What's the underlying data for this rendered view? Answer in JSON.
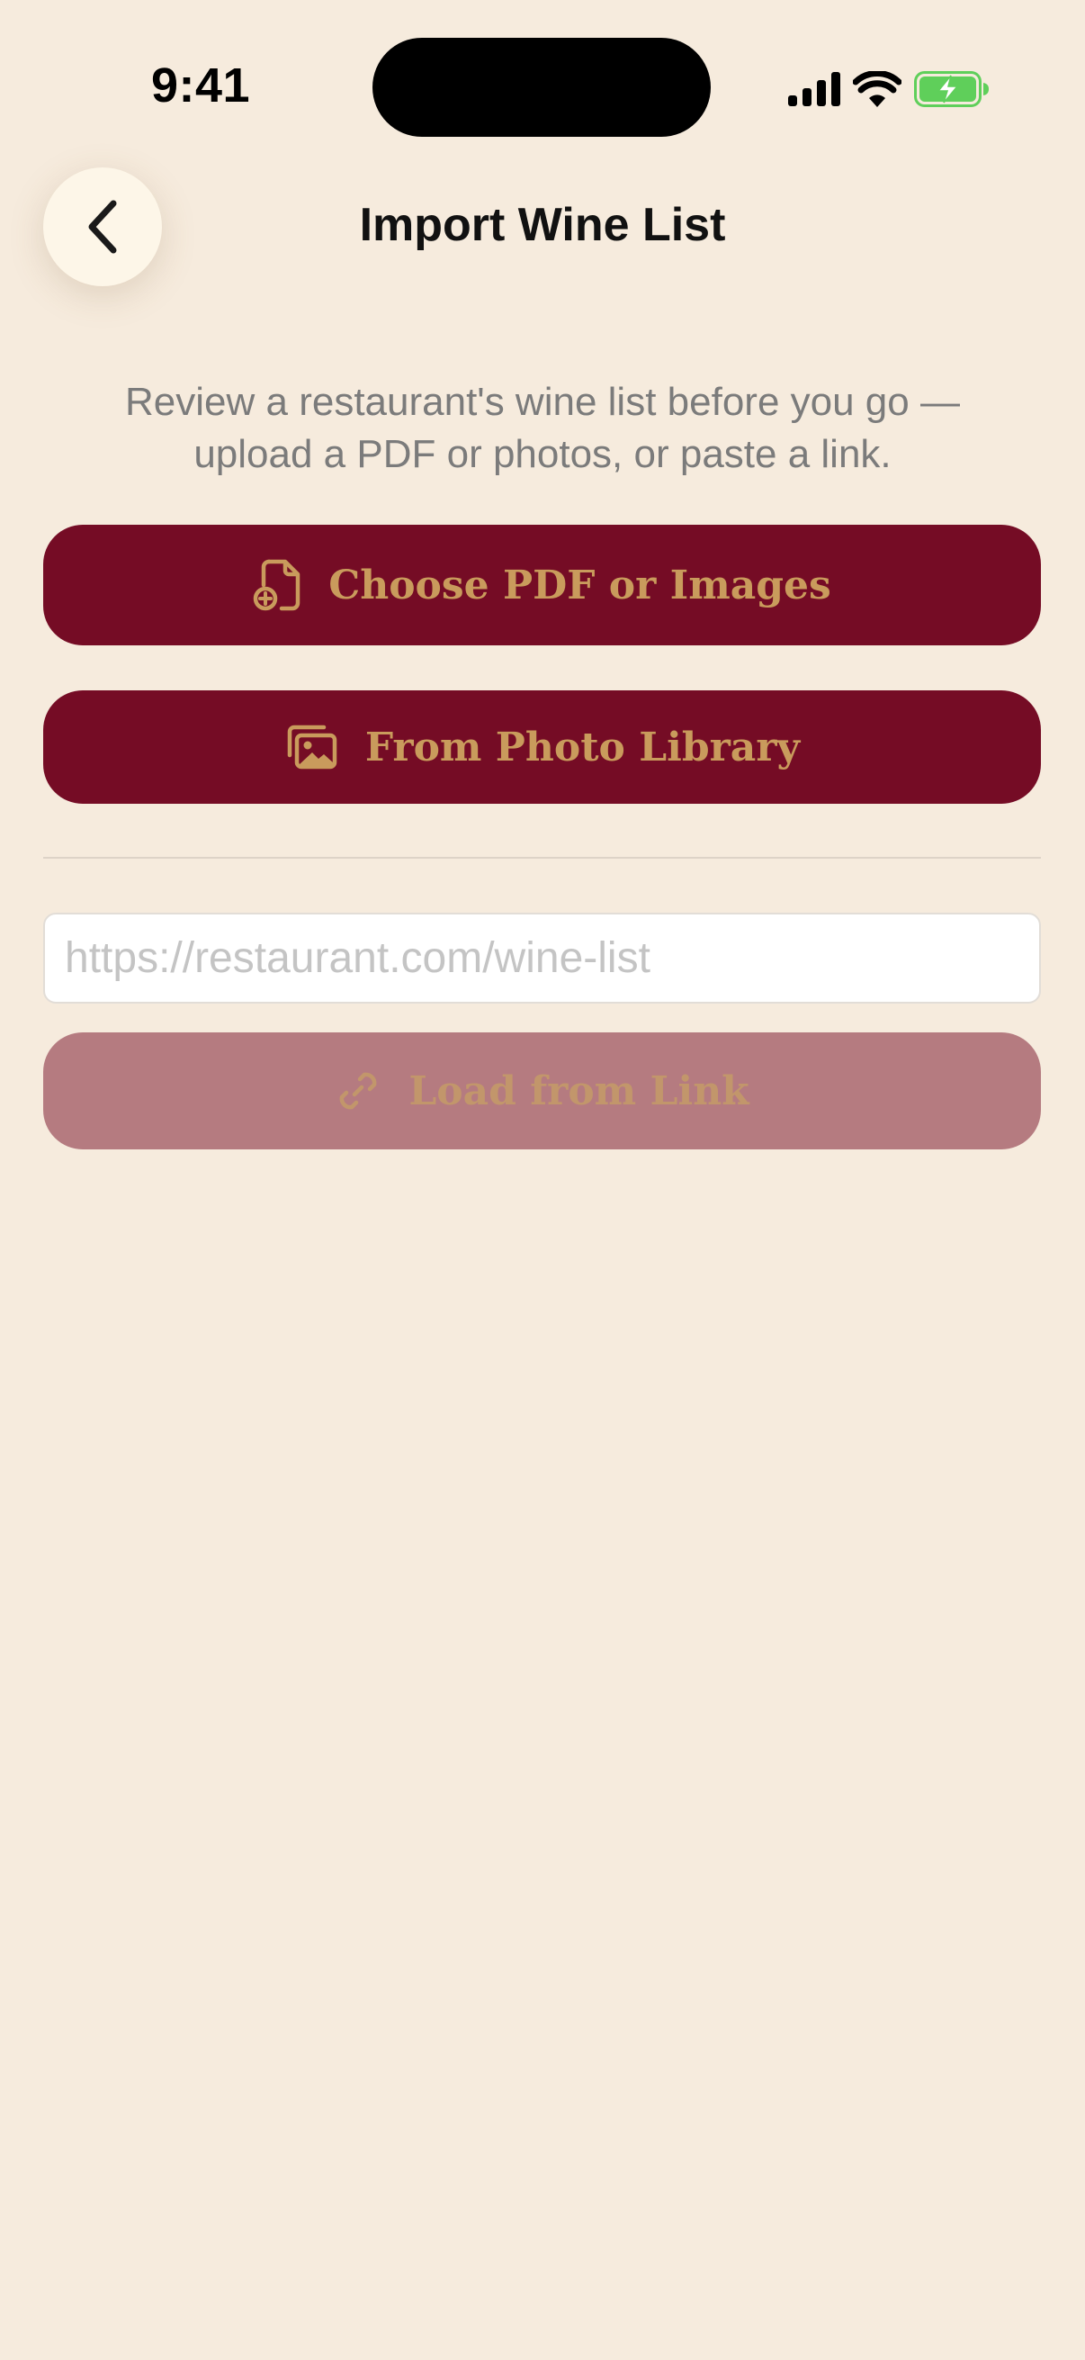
{
  "status_bar": {
    "time": "9:41"
  },
  "nav": {
    "title": "Import Wine List",
    "back_icon": "chevron-left-icon"
  },
  "description": "Review a restaurant's wine list before you go — upload a PDF or photos, or paste a link.",
  "actions": {
    "choose_files": {
      "label": "Choose PDF or Images",
      "icon": "document-add-icon"
    },
    "photo_library": {
      "label": "From Photo Library",
      "icon": "photo-library-icon"
    }
  },
  "link_import": {
    "url_value": "",
    "url_placeholder": "https://restaurant.com/wine-list",
    "load_button": {
      "label": "Load from Link",
      "icon": "link-icon",
      "enabled": false
    }
  },
  "colors": {
    "background": "#f6ebdd",
    "primary": "#750c25",
    "primary_disabled": "#b57b80",
    "accent_gold": "#c99b5c",
    "muted_text": "#7b7b7b",
    "battery_green": "#5fcf5a"
  }
}
